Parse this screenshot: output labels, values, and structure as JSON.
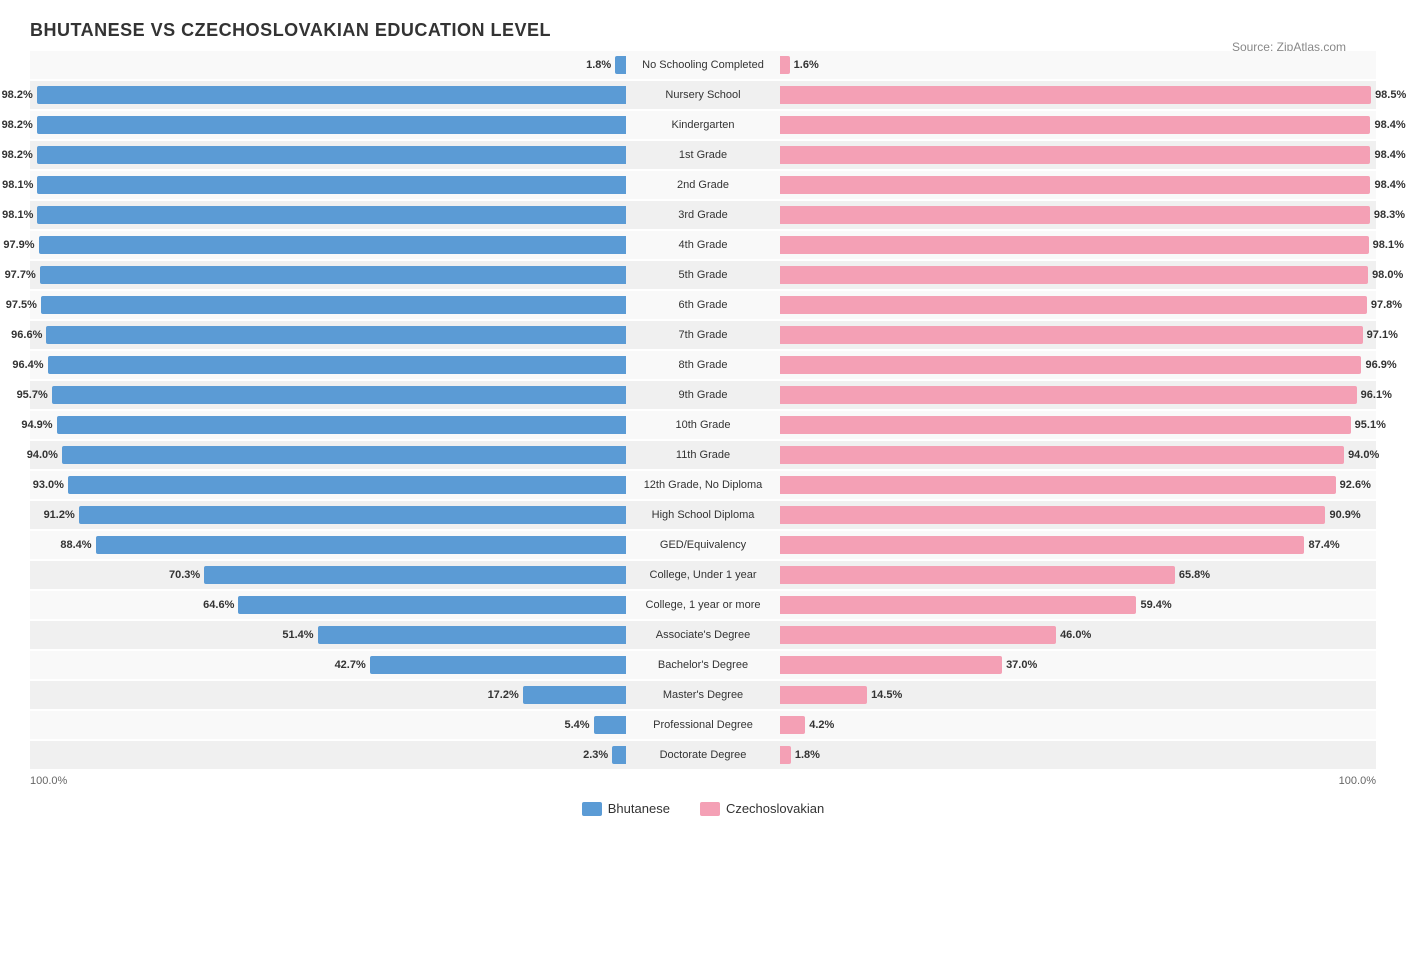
{
  "title": "BHUTANESE VS CZECHOSLOVAKIAN EDUCATION LEVEL",
  "source": "Source: ZipAtlas.com",
  "legend": {
    "left_label": "Bhutanese",
    "right_label": "Czechoslovakian",
    "left_color": "#5b9bd5",
    "right_color": "#f4a0b5"
  },
  "axis": {
    "left": "100.0%",
    "right": "100.0%"
  },
  "rows": [
    {
      "label": "No Schooling Completed",
      "left_val": "1.8%",
      "right_val": "1.6%",
      "left_pct": 1.8,
      "right_pct": 1.6
    },
    {
      "label": "Nursery School",
      "left_val": "98.2%",
      "right_val": "98.5%",
      "left_pct": 98.2,
      "right_pct": 98.5
    },
    {
      "label": "Kindergarten",
      "left_val": "98.2%",
      "right_val": "98.4%",
      "left_pct": 98.2,
      "right_pct": 98.4
    },
    {
      "label": "1st Grade",
      "left_val": "98.2%",
      "right_val": "98.4%",
      "left_pct": 98.2,
      "right_pct": 98.4
    },
    {
      "label": "2nd Grade",
      "left_val": "98.1%",
      "right_val": "98.4%",
      "left_pct": 98.1,
      "right_pct": 98.4
    },
    {
      "label": "3rd Grade",
      "left_val": "98.1%",
      "right_val": "98.3%",
      "left_pct": 98.1,
      "right_pct": 98.3
    },
    {
      "label": "4th Grade",
      "left_val": "97.9%",
      "right_val": "98.1%",
      "left_pct": 97.9,
      "right_pct": 98.1
    },
    {
      "label": "5th Grade",
      "left_val": "97.7%",
      "right_val": "98.0%",
      "left_pct": 97.7,
      "right_pct": 98.0
    },
    {
      "label": "6th Grade",
      "left_val": "97.5%",
      "right_val": "97.8%",
      "left_pct": 97.5,
      "right_pct": 97.8
    },
    {
      "label": "7th Grade",
      "left_val": "96.6%",
      "right_val": "97.1%",
      "left_pct": 96.6,
      "right_pct": 97.1
    },
    {
      "label": "8th Grade",
      "left_val": "96.4%",
      "right_val": "96.9%",
      "left_pct": 96.4,
      "right_pct": 96.9
    },
    {
      "label": "9th Grade",
      "left_val": "95.7%",
      "right_val": "96.1%",
      "left_pct": 95.7,
      "right_pct": 96.1
    },
    {
      "label": "10th Grade",
      "left_val": "94.9%",
      "right_val": "95.1%",
      "left_pct": 94.9,
      "right_pct": 95.1
    },
    {
      "label": "11th Grade",
      "left_val": "94.0%",
      "right_val": "94.0%",
      "left_pct": 94.0,
      "right_pct": 94.0
    },
    {
      "label": "12th Grade, No Diploma",
      "left_val": "93.0%",
      "right_val": "92.6%",
      "left_pct": 93.0,
      "right_pct": 92.6
    },
    {
      "label": "High School Diploma",
      "left_val": "91.2%",
      "right_val": "90.9%",
      "left_pct": 91.2,
      "right_pct": 90.9
    },
    {
      "label": "GED/Equivalency",
      "left_val": "88.4%",
      "right_val": "87.4%",
      "left_pct": 88.4,
      "right_pct": 87.4
    },
    {
      "label": "College, Under 1 year",
      "left_val": "70.3%",
      "right_val": "65.8%",
      "left_pct": 70.3,
      "right_pct": 65.8
    },
    {
      "label": "College, 1 year or more",
      "left_val": "64.6%",
      "right_val": "59.4%",
      "left_pct": 64.6,
      "right_pct": 59.4
    },
    {
      "label": "Associate's Degree",
      "left_val": "51.4%",
      "right_val": "46.0%",
      "left_pct": 51.4,
      "right_pct": 46.0
    },
    {
      "label": "Bachelor's Degree",
      "left_val": "42.7%",
      "right_val": "37.0%",
      "left_pct": 42.7,
      "right_pct": 37.0
    },
    {
      "label": "Master's Degree",
      "left_val": "17.2%",
      "right_val": "14.5%",
      "left_pct": 17.2,
      "right_pct": 14.5
    },
    {
      "label": "Professional Degree",
      "left_val": "5.4%",
      "right_val": "4.2%",
      "left_pct": 5.4,
      "right_pct": 4.2
    },
    {
      "label": "Doctorate Degree",
      "left_val": "2.3%",
      "right_val": "1.8%",
      "left_pct": 2.3,
      "right_pct": 1.8
    }
  ]
}
